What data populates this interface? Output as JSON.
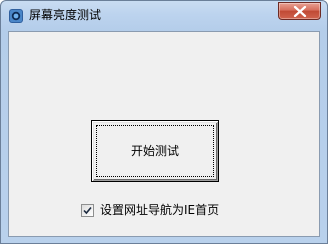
{
  "window": {
    "title": "屏幕亮度测试",
    "icon": "app-icon",
    "close_icon": "close-icon"
  },
  "main": {
    "start_button_label": "开始测试",
    "set_homepage_checkbox": {
      "label": "设置网址导航为IE首页",
      "checked": true
    }
  },
  "colors": {
    "titlebar": "#b9d1ec",
    "close_button": "#c04a35",
    "client_bg": "#f0f0f0"
  }
}
